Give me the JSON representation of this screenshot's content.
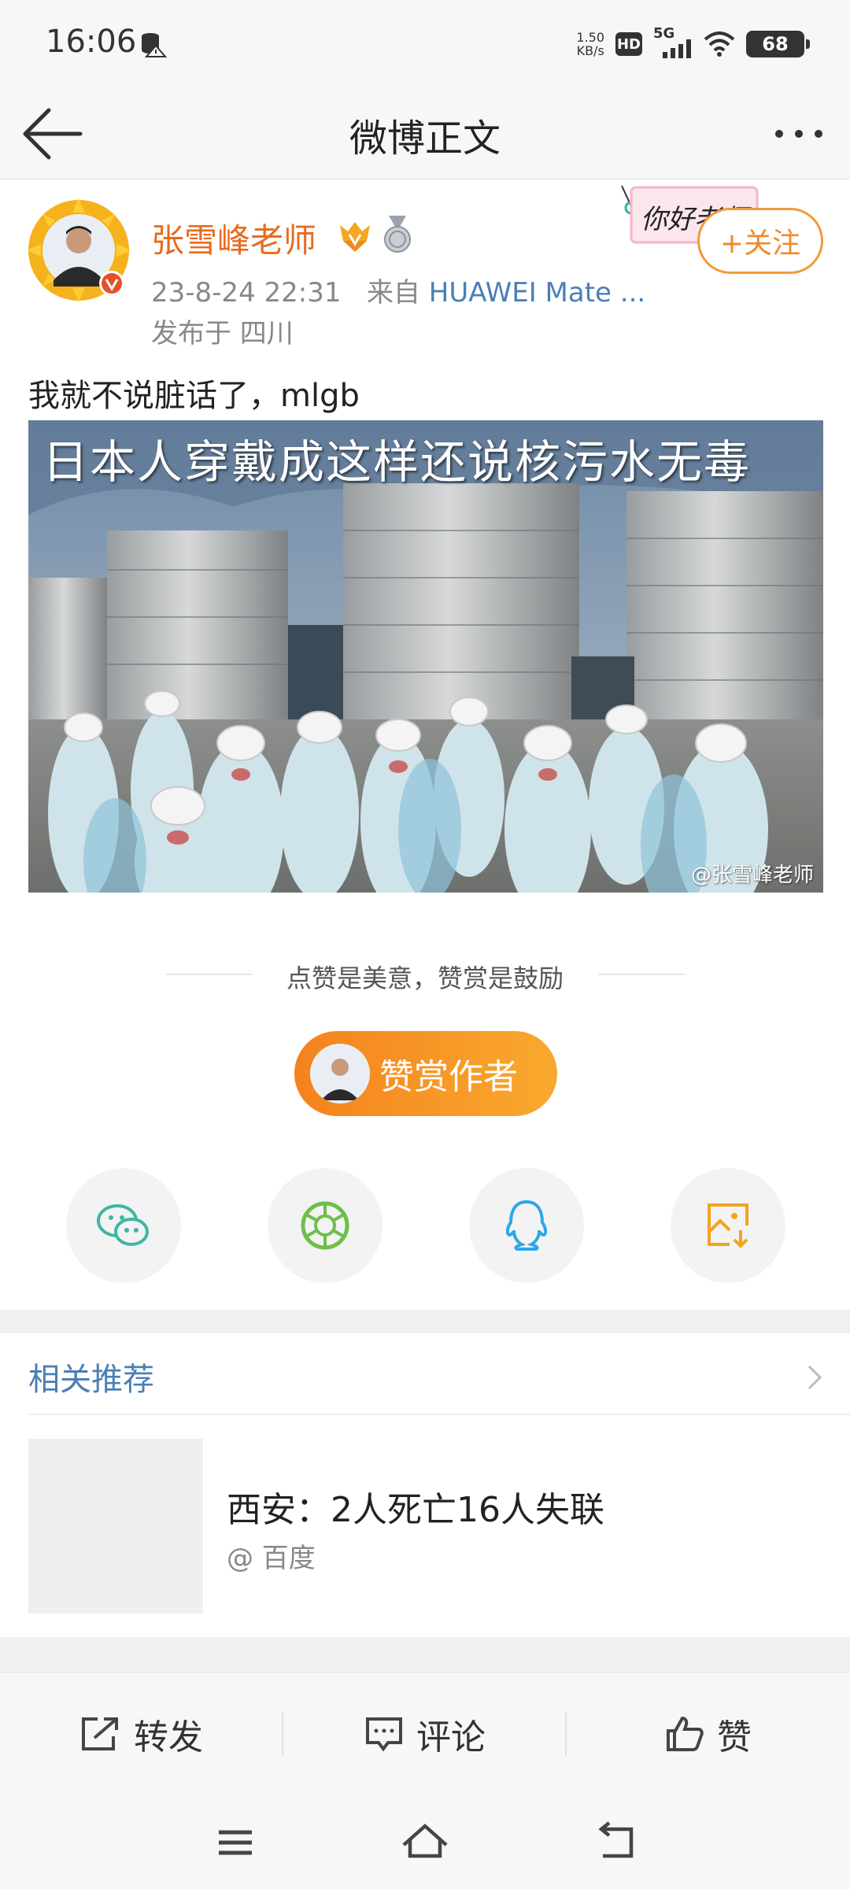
{
  "status_bar": {
    "time": "16:06",
    "speed_value": "1.50",
    "speed_unit": "KB/s",
    "hd": "HD",
    "network": "5G",
    "battery": "68"
  },
  "header": {
    "title": "微博正文"
  },
  "post": {
    "author": "张雪峰老师",
    "datetime": "23-8-24 22:31",
    "source_prefix": "来自",
    "source": "HUAWEI Mate ...",
    "location": "发布于 四川",
    "follow_label": "+关注",
    "sticker_text": "你好老师",
    "text": "我就不说脏话了，mlgb",
    "image_caption": "日本人穿戴成这样还说核污水无毒",
    "image_watermark": "@张雪峰老师"
  },
  "reward": {
    "tagline": "点赞是美意，赞赏是鼓励",
    "button_label": "赞赏作者"
  },
  "share": [
    {
      "icon": "wechat-icon"
    },
    {
      "icon": "moments-icon"
    },
    {
      "icon": "qq-icon"
    },
    {
      "icon": "save-image-icon"
    }
  ],
  "related": {
    "title": "相关推荐",
    "items": [
      {
        "headline": "西安：2人死亡16人失联",
        "source": "@ 百度"
      }
    ]
  },
  "actions": {
    "repost": "转发",
    "comment": "评论",
    "like": "赞"
  },
  "colors": {
    "brand_orange": "#f4821e",
    "link_blue": "#4a7fb5",
    "author_orange": "#e86b1f"
  }
}
